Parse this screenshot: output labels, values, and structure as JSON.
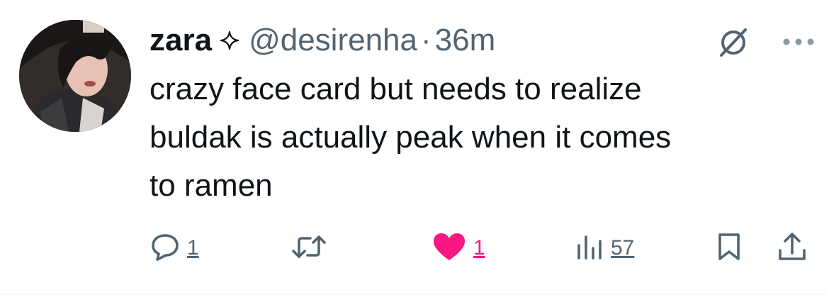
{
  "user": {
    "display_name": "zara",
    "handle": "@desirenha",
    "separator": "·",
    "time": "36m",
    "verified_icon": "sparkle-icon"
  },
  "post": {
    "lines": [
      "crazy face card but needs to realize",
      "buldak is actually peak when it comes",
      "to ramen"
    ]
  },
  "actions": {
    "replies": "1",
    "likes": "1",
    "liked": true,
    "views": "57"
  },
  "icons": {
    "mute": "mute-slash-icon",
    "more": "more-dots-icon",
    "reply": "reply-icon",
    "repost": "repost-icon",
    "like": "heart-icon",
    "views": "views-bar-chart-icon",
    "bookmark": "bookmark-icon",
    "share": "share-icon"
  },
  "colors": {
    "text": "#0f1419",
    "secondary": "#536471",
    "like": "#f91880",
    "icon_light": "#8899a6"
  }
}
